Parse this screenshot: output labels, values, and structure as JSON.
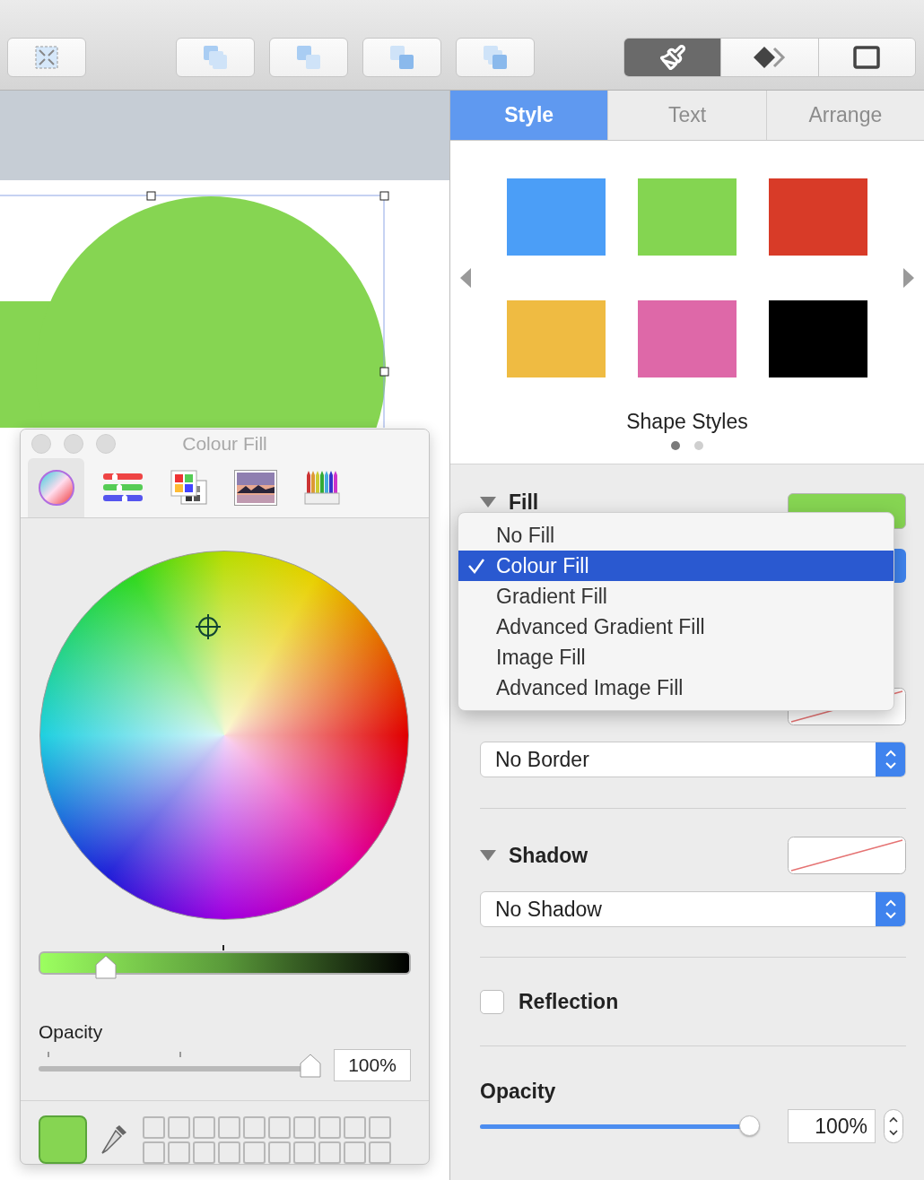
{
  "toolbar": {
    "buttons": [
      {
        "kind": "fit"
      },
      {
        "kind": "front"
      },
      {
        "kind": "forward"
      },
      {
        "kind": "backward"
      },
      {
        "kind": "back"
      }
    ],
    "inspector_modes": [
      {
        "kind": "brush",
        "selected": true
      },
      {
        "kind": "diamond",
        "selected": false
      },
      {
        "kind": "window",
        "selected": false
      }
    ]
  },
  "colour_window": {
    "title": "Colour Fill",
    "modes": [
      {
        "kind": "wheel",
        "selected": true
      },
      {
        "kind": "sliders",
        "selected": false
      },
      {
        "kind": "palettes",
        "selected": false
      },
      {
        "kind": "image",
        "selected": false
      },
      {
        "kind": "pencils",
        "selected": false
      }
    ],
    "brightness": {
      "level": 0.18
    },
    "opacity": {
      "label": "Opacity",
      "level": 1,
      "value": "100%"
    }
  },
  "tabs": [
    {
      "label": "Style",
      "selected": true
    },
    {
      "label": "Text",
      "selected": false
    },
    {
      "label": "Arrange",
      "selected": false
    }
  ],
  "shape_styles": {
    "title": "Shape Styles",
    "swatches": [
      {
        "color": "#4b9ef7"
      },
      {
        "color": "#84d551"
      },
      {
        "color": "#d83b28"
      },
      {
        "color": "#efbb42"
      },
      {
        "color": "#de68a8"
      },
      {
        "color": "#000000"
      }
    ],
    "pages": [
      {
        "selected": true
      },
      {
        "selected": false
      }
    ]
  },
  "fill": {
    "label": "Fill",
    "menu": [
      {
        "label": "No Fill",
        "selected": false
      },
      {
        "label": "Colour Fill",
        "selected": true
      },
      {
        "label": "Gradient Fill",
        "selected": false
      },
      {
        "label": "Advanced Gradient Fill",
        "selected": false
      },
      {
        "label": "Image Fill",
        "selected": false
      },
      {
        "label": "Advanced Image Fill",
        "selected": false
      }
    ]
  },
  "border": {
    "value": "No Border"
  },
  "shadow": {
    "label": "Shadow",
    "value": "No Shadow"
  },
  "reflection": {
    "label": "Reflection",
    "checked": false
  },
  "opacity": {
    "label": "Opacity",
    "level": 0.96,
    "value": "100%"
  }
}
